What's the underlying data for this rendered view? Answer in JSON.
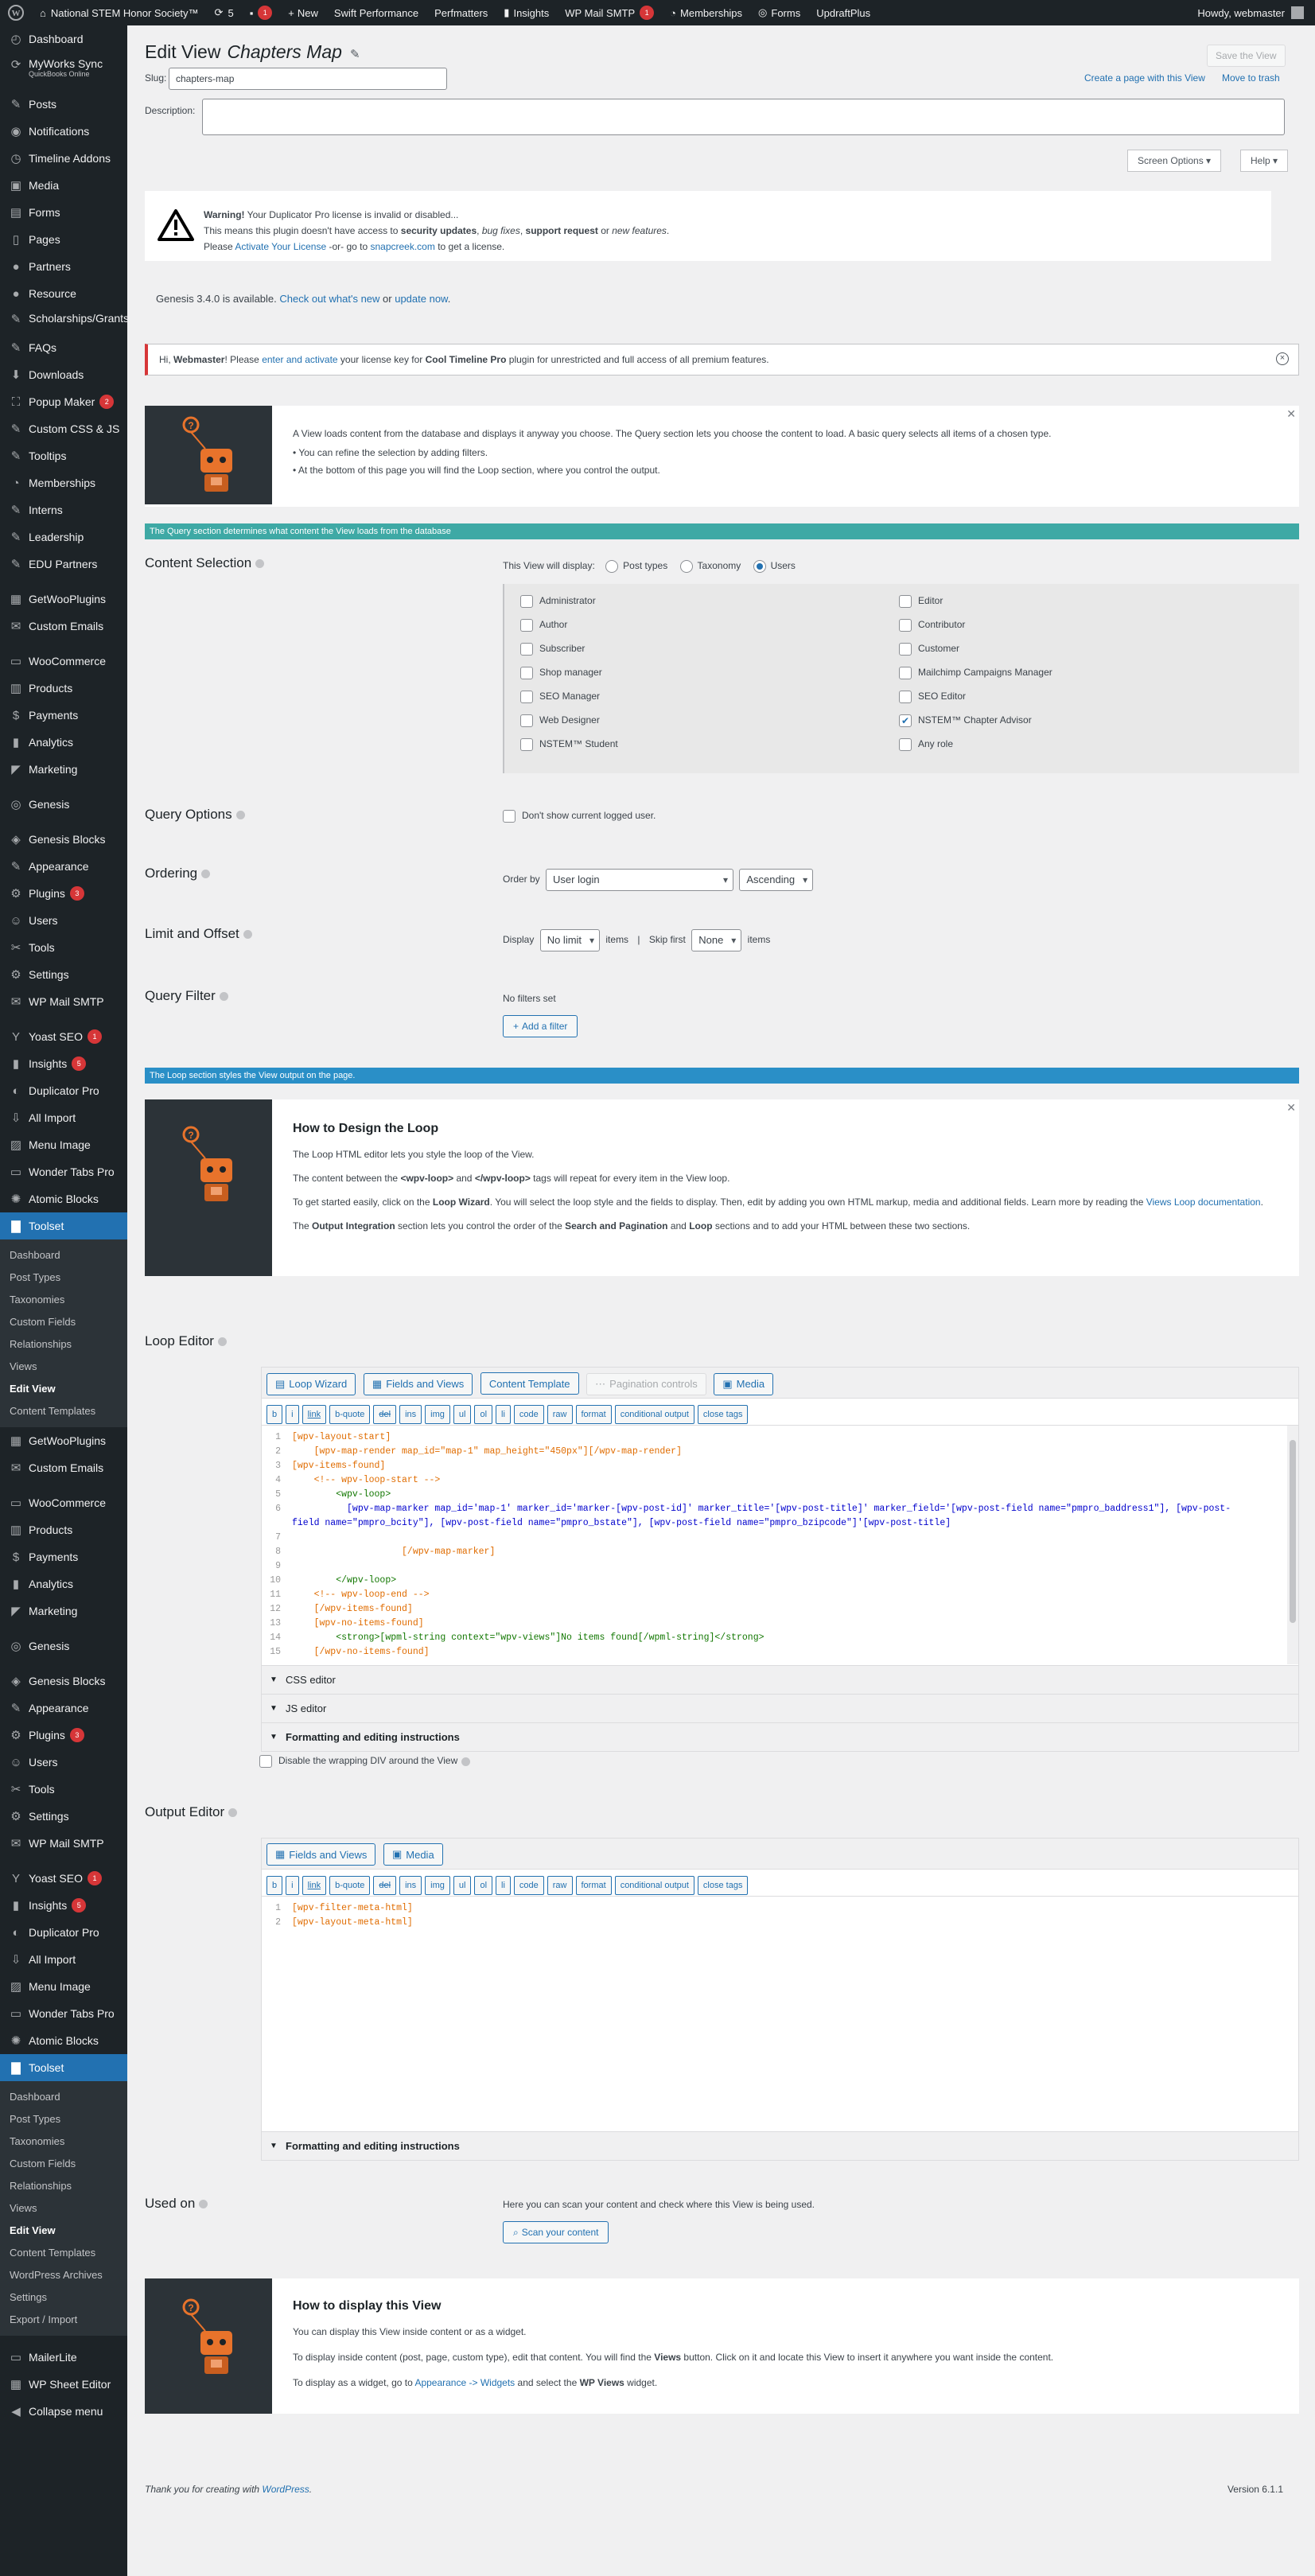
{
  "adminbar": {
    "site": "National STEM Honor Society™",
    "updates": "5",
    "comments": "1",
    "new": "New",
    "swift": "Swift Performance",
    "perfmatters": "Perfmatters",
    "insights": "Insights",
    "wpmail": "WP Mail SMTP",
    "wpmail_badge": "1",
    "memberships": "Memberships",
    "forms": "Forms",
    "updraft": "UpdraftPlus",
    "howdy": "Howdy, webmaster"
  },
  "menu": {
    "top": [
      {
        "label": "Dashboard",
        "icon": "dashboard-icon"
      },
      {
        "label": "MyWorks Sync",
        "sub": "QuickBooks Online",
        "icon": "sync-icon"
      },
      {
        "label": "Posts",
        "icon": "pin-icon"
      },
      {
        "label": "Notifications",
        "icon": "bell-icon"
      },
      {
        "label": "Timeline Addons",
        "icon": "timeline-icon"
      },
      {
        "label": "Media",
        "icon": "media-icon"
      },
      {
        "label": "Forms",
        "icon": "forms-icon"
      },
      {
        "label": "Pages",
        "icon": "pages-icon"
      },
      {
        "label": "Partners",
        "icon": "partners-icon"
      },
      {
        "label": "Resource",
        "icon": "resource-icon"
      },
      {
        "label": "Scholarships/Grants",
        "icon": "scholarship-icon"
      },
      {
        "label": "FAQs",
        "icon": "faq-icon"
      },
      {
        "label": "Downloads",
        "icon": "download-icon"
      },
      {
        "label": "Popup Maker",
        "icon": "popup-icon",
        "badge": "2"
      },
      {
        "label": "Custom CSS & JS",
        "icon": "code-icon"
      },
      {
        "label": "Tooltips",
        "icon": "tooltip-icon"
      },
      {
        "label": "Memberships",
        "icon": "membership-icon"
      },
      {
        "label": "Interns",
        "icon": "interns-icon"
      },
      {
        "label": "Leadership",
        "icon": "leadership-icon"
      },
      {
        "label": "EDU Partners",
        "icon": "edu-icon"
      },
      {
        "label": "GetWooPlugins",
        "icon": "plugin-icon"
      },
      {
        "label": "Custom Emails",
        "icon": "email-icon"
      },
      {
        "label": "WooCommerce",
        "icon": "woo-icon"
      },
      {
        "label": "Products",
        "icon": "products-icon"
      },
      {
        "label": "Payments",
        "icon": "payments-icon"
      },
      {
        "label": "Analytics",
        "icon": "analytics-icon"
      },
      {
        "label": "Marketing",
        "icon": "marketing-icon"
      },
      {
        "label": "Genesis",
        "icon": "genesis-icon"
      },
      {
        "label": "Genesis Blocks",
        "icon": "blocks-icon"
      },
      {
        "label": "Appearance",
        "icon": "appearance-icon"
      },
      {
        "label": "Plugins",
        "icon": "plugins-icon",
        "badge": "3"
      },
      {
        "label": "Users",
        "icon": "users-icon"
      },
      {
        "label": "Tools",
        "icon": "tools-icon"
      },
      {
        "label": "Settings",
        "icon": "settings-icon"
      },
      {
        "label": "WP Mail SMTP",
        "icon": "mail-icon"
      },
      {
        "label": "Yoast SEO",
        "icon": "yoast-icon",
        "badge": "1"
      },
      {
        "label": "Insights",
        "icon": "insights-icon",
        "badge": "5"
      },
      {
        "label": "Duplicator Pro",
        "icon": "duplicator-icon"
      },
      {
        "label": "All Import",
        "icon": "import-icon"
      },
      {
        "label": "Menu Image",
        "icon": "image-icon"
      },
      {
        "label": "Wonder Tabs Pro",
        "icon": "tabs-icon"
      },
      {
        "label": "Atomic Blocks",
        "icon": "atomic-icon"
      },
      {
        "label": "Toolset",
        "icon": "toolset-icon"
      }
    ],
    "submenu1": [
      "Dashboard",
      "Post Types",
      "Taxonomies",
      "Custom Fields",
      "Relationships",
      "Views",
      "Edit View",
      "Content Templates"
    ],
    "mid": [
      {
        "label": "GetWooPlugins",
        "icon": "plugin-icon"
      },
      {
        "label": "Custom Emails",
        "icon": "email-icon"
      },
      {
        "label": "WooCommerce",
        "icon": "woo-icon"
      },
      {
        "label": "Products",
        "icon": "products-icon"
      },
      {
        "label": "Payments",
        "icon": "payments-icon"
      },
      {
        "label": "Analytics",
        "icon": "analytics-icon"
      },
      {
        "label": "Marketing",
        "icon": "marketing-icon"
      },
      {
        "label": "Genesis",
        "icon": "genesis-icon"
      },
      {
        "label": "Genesis Blocks",
        "icon": "blocks-icon"
      },
      {
        "label": "Appearance",
        "icon": "appearance-icon"
      },
      {
        "label": "Plugins",
        "icon": "plugins-icon",
        "badge": "3"
      },
      {
        "label": "Users",
        "icon": "users-icon"
      },
      {
        "label": "Tools",
        "icon": "tools-icon"
      },
      {
        "label": "Settings",
        "icon": "settings-icon"
      },
      {
        "label": "WP Mail SMTP",
        "icon": "mail-icon"
      },
      {
        "label": "Yoast SEO",
        "icon": "yoast-icon",
        "badge": "1"
      },
      {
        "label": "Insights",
        "icon": "insights-icon",
        "badge": "5"
      },
      {
        "label": "Duplicator Pro",
        "icon": "duplicator-icon"
      },
      {
        "label": "All Import",
        "icon": "import-icon"
      },
      {
        "label": "Menu Image",
        "icon": "image-icon"
      },
      {
        "label": "Wonder Tabs Pro",
        "icon": "tabs-icon"
      },
      {
        "label": "Atomic Blocks",
        "icon": "atomic-icon"
      },
      {
        "label": "Toolset",
        "icon": "toolset-icon"
      }
    ],
    "submenu2": [
      "Dashboard",
      "Post Types",
      "Taxonomies",
      "Custom Fields",
      "Relationships",
      "Views",
      "Edit View",
      "Content Templates",
      "WordPress Archives",
      "Settings",
      "Export / Import"
    ],
    "bottom": [
      {
        "label": "MailerLite",
        "icon": "mailerlite-icon"
      },
      {
        "label": "WP Sheet Editor",
        "icon": "sheet-icon"
      },
      {
        "label": "Collapse menu",
        "icon": "collapse-icon"
      }
    ]
  },
  "header": {
    "title": "Edit View",
    "view_name": "Chapters Map",
    "save": "Save the View",
    "create_page": "Create a page with this View",
    "trash": "Move to trash",
    "slug_label": "Slug:",
    "slug": "chapters-map",
    "desc_label": "Description:",
    "screen_options": "Screen Options",
    "help": "Help"
  },
  "notices": {
    "dup_warning": "Warning!",
    "dup_1": "Your Duplicator Pro license is invalid or disabled...",
    "dup_2a": "This means this plugin doesn't have access to ",
    "dup_2b": "security updates",
    "dup_2c": "bug fixes",
    "dup_2d": "support request",
    "dup_2e": " or ",
    "dup_2f": "new features",
    "dup_3a": "Please ",
    "dup_3b": "Activate Your License",
    "dup_3c": " -or- go to ",
    "dup_3d": "snapcreek.com",
    "dup_3e": " to get a license.",
    "genesis_a": "Genesis 3.4.0 is available. ",
    "genesis_b": "Check out what's new",
    "genesis_c": " or ",
    "genesis_d": "update now",
    "timeline_a": "Hi, ",
    "timeline_b": "Webmaster",
    "timeline_c": "! Please ",
    "timeline_d": "enter and activate",
    "timeline_e": " your license key for ",
    "timeline_f": "Cool Timeline Pro",
    "timeline_g": " plugin for unrestricted and full access of all premium features."
  },
  "intro": {
    "p": "A View loads content from the database and displays it anyway you choose. The Query section lets you choose the content to load. A basic query selects all items of a chosen type.",
    "b1": "You can refine the selection by adding filters.",
    "b2": "At the bottom of this page you will find the Loop section, where you control the output."
  },
  "query_bar": "The Query section determines what content the View loads from the database",
  "content_selection": {
    "title": "Content Selection",
    "display_label": "This View will display:",
    "opt_post": "Post types",
    "opt_tax": "Taxonomy",
    "opt_users": "Users",
    "roles": [
      {
        "name": "Administrator",
        "checked": false
      },
      {
        "name": "Editor",
        "checked": false
      },
      {
        "name": "Author",
        "checked": false
      },
      {
        "name": "Contributor",
        "checked": false
      },
      {
        "name": "Subscriber",
        "checked": false
      },
      {
        "name": "Customer",
        "checked": false
      },
      {
        "name": "Shop manager",
        "checked": false
      },
      {
        "name": "Mailchimp Campaigns Manager",
        "checked": false
      },
      {
        "name": "SEO Manager",
        "checked": false
      },
      {
        "name": "SEO Editor",
        "checked": false
      },
      {
        "name": "Web Designer",
        "checked": false
      },
      {
        "name": "NSTEM™ Chapter Advisor",
        "checked": true
      },
      {
        "name": "NSTEM™ Student",
        "checked": false
      },
      {
        "name": "Any role",
        "checked": false
      }
    ]
  },
  "query_options": {
    "title": "Query Options",
    "label": "Don't show current logged user."
  },
  "ordering": {
    "title": "Ordering",
    "order_by": "Order by",
    "field": "User login",
    "dir": "Ascending"
  },
  "limit": {
    "title": "Limit and Offset",
    "display": "Display",
    "limit_val": "No limit",
    "items": "items",
    "sep": "|",
    "skip": "Skip first",
    "skip_val": "None",
    "items2": "items"
  },
  "query_filter": {
    "title": "Query Filter",
    "none": "No filters set",
    "add": "Add a filter"
  },
  "loop_bar": "The Loop section styles the View output on the page.",
  "design": {
    "title": "How to Design the Loop",
    "p1": "The Loop HTML editor lets you style the loop of the View.",
    "p2a": "The content between the ",
    "p2b": "<wpv-loop>",
    "p2c": " and ",
    "p2d": "</wpv-loop>",
    "p2e": " tags will repeat for every item in the View loop.",
    "p3a": "To get started easily, click on the ",
    "p3b": "Loop Wizard",
    "p3c": ". You will select the loop style and the fields to display. Then, edit by adding you own HTML markup, media and additional fields. Learn more by reading the ",
    "p3d": "Views Loop documentation",
    "p3e": ".",
    "p4a": "The ",
    "p4b": "Output Integration",
    "p4c": " section lets you control the order of the ",
    "p4d": "Search and Pagination",
    "p4e": " and ",
    "p4f": "Loop",
    "p4g": " sections and to add your HTML between these two sections."
  },
  "loop_editor": {
    "title": "Loop Editor",
    "tabs": [
      "Loop Wizard",
      "Fields and Views",
      "Content Template",
      "Pagination controls",
      "Media"
    ],
    "quicktags": [
      "b",
      "i",
      "link",
      "b-quote",
      "del",
      "ins",
      "img",
      "ul",
      "ol",
      "li",
      "code",
      "raw",
      "format",
      "conditional output",
      "close tags"
    ],
    "css": "CSS editor",
    "js": "JS editor",
    "fmt": "Formatting and editing instructions",
    "wrap": "Disable the wrapping DIV around the View",
    "lines": [
      "[wpv-layout-start]",
      "    [wpv-map-render map_id=\"map-1\" map_height=\"450px\"][/wpv-map-render]",
      "[wpv-items-found]",
      "    <!-- wpv-loop-start -->",
      "        <wpv-loop>",
      "          [wpv-map-marker map_id='map-1' marker_id='marker-[wpv-post-id]' marker_title='[wpv-post-title]' marker_field='[wpv-post-field name=\"pmpro_baddress1\"], [wpv-post-",
      "field name=\"pmpro_bcity\"], [wpv-post-field name=\"pmpro_bstate\"], [wpv-post-field name=\"pmpro_bzipcode\"]'[wpv-post-title]",
      "",
      "                    [/wpv-map-marker]",
      "",
      "        </wpv-loop>",
      "    <!-- wpv-loop-end -->",
      "    [/wpv-items-found]",
      "    [wpv-no-items-found]",
      "        <strong>[wpml-string context=\"wpv-views\"]No items found[/wpml-string]</strong>",
      "    [/wpv-no-items-found]"
    ],
    "nums": [
      "1",
      "2",
      "3",
      "4",
      "5",
      "6",
      "",
      "7",
      "8",
      "9",
      "10",
      "11",
      "12",
      "13",
      "14",
      "15"
    ]
  },
  "output_editor": {
    "title": "Output Editor",
    "tabs": [
      "Fields and Views",
      "Media"
    ],
    "lines": [
      "[wpv-filter-meta-html]",
      "[wpv-layout-meta-html]"
    ],
    "fmt": "Formatting and editing instructions"
  },
  "used_on": {
    "title": "Used on",
    "text": "Here you can scan your content and check where this View is being used.",
    "btn": "Scan your content"
  },
  "display": {
    "title": "How to display this View",
    "p1": "You can display this View inside content or as a widget.",
    "p2a": "To display inside content (post, page, custom type), edit that content. You will find the ",
    "p2b": "Views",
    "p2c": " button. Click on it and locate this View to insert it anywhere you want inside the content.",
    "p3a": "To display as a widget, go to ",
    "p3b": "Appearance -> Widgets",
    "p3c": " and select the ",
    "p3d": "WP Views",
    "p3e": " widget."
  },
  "footer": {
    "thanks": "Thank you for creating with ",
    "wp": "WordPress",
    "version": "Version 6.1.1"
  },
  "colors": {
    "teal": "#3ea9a5",
    "blue": "#2a8fc7",
    "accent": "#2271b1",
    "robot_orange": "#e8732b"
  }
}
